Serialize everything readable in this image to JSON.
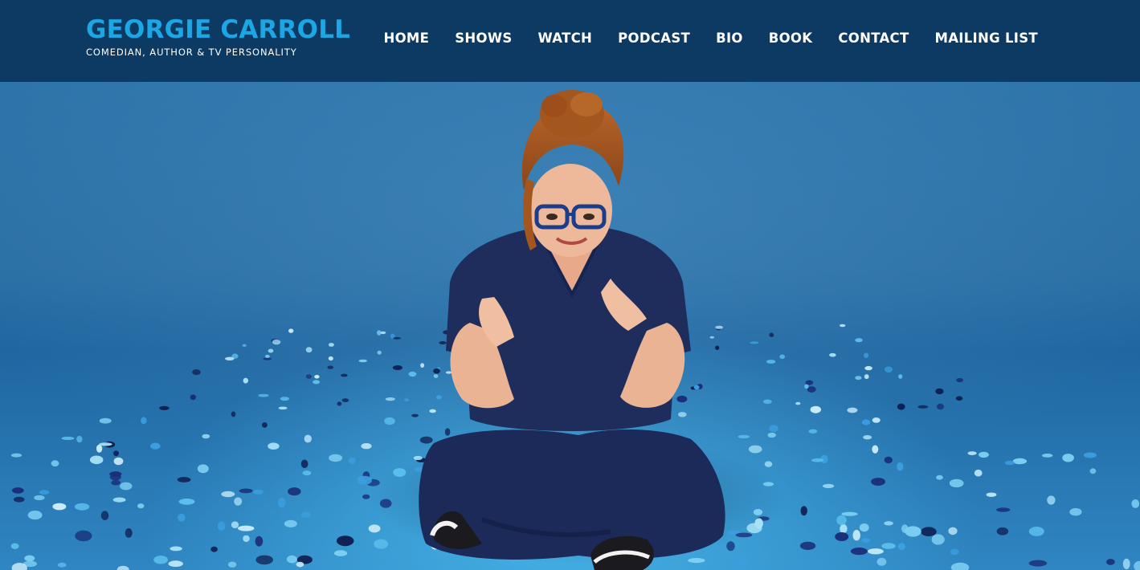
{
  "site": {
    "title": "GEORGIE CARROLL",
    "tagline": "COMEDIAN, AUTHOR & TV PERSONALITY"
  },
  "nav": {
    "items": [
      {
        "label": "HOME"
      },
      {
        "label": "SHOWS"
      },
      {
        "label": "WATCH"
      },
      {
        "label": "PODCAST"
      },
      {
        "label": "BIO"
      },
      {
        "label": "BOOK"
      },
      {
        "label": "CONTACT"
      },
      {
        "label": "MAILING LIST"
      }
    ]
  },
  "colors": {
    "header_bg": "#0c3a62",
    "brand_accent": "#1ba6e6",
    "hero_bg": "#2a6fa3",
    "scrubs": "#1d2c5a"
  }
}
